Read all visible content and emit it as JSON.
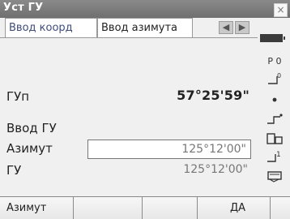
{
  "window": {
    "title": "Уст ГУ",
    "close_symbol": "×"
  },
  "tabs": [
    {
      "label": "Ввод коорд"
    },
    {
      "label": "Ввод азимута"
    }
  ],
  "tab_nav": {
    "left": "◀",
    "right": "▶"
  },
  "fields": {
    "gup_label": "ГУп",
    "gup_value": "57°25'59\"",
    "vvod_gu_label": "Ввод ГУ",
    "azimut_label": "Азимут",
    "azimut_value": "125°12'00\"",
    "gu_label": "ГУ",
    "gu_value": "125°12'00\""
  },
  "sidebar": {
    "battery_icon": "battery-icon",
    "p0_text": "P 0",
    "items": [
      "target-prism-icon",
      "dot-icon",
      "level-icon",
      "prism-icon",
      "step-icon",
      "keyboard-icon"
    ]
  },
  "softkeys": [
    "Азимут",
    "",
    "",
    "ДА",
    ""
  ],
  "colors": {
    "titlebar": "#7a7a7a",
    "background": "#f0f0f0",
    "value_gray": "#777777"
  }
}
